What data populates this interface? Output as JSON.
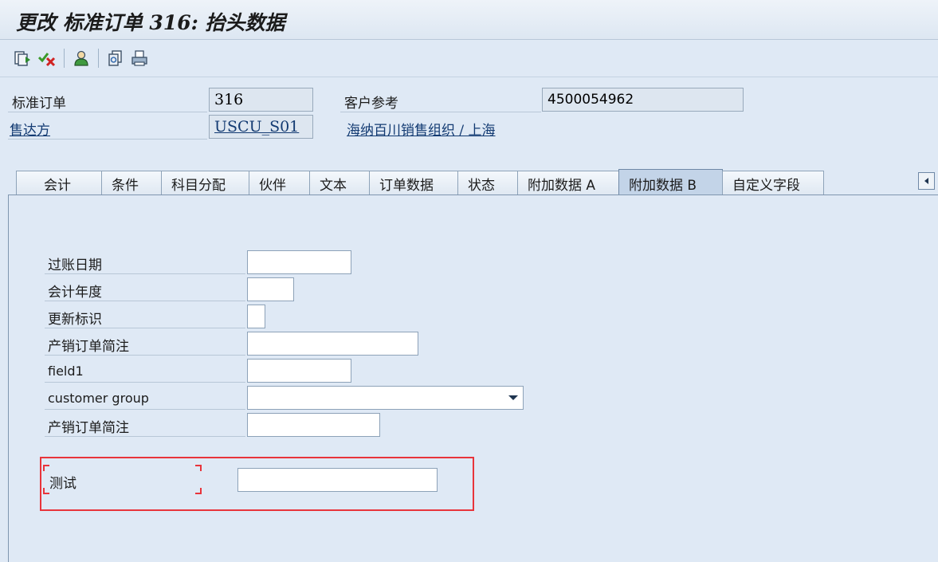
{
  "window": {
    "title": "更改 标准订单 316: 抬头数据"
  },
  "toolbar": {
    "buttons": [
      {
        "icon": "display-change-icon"
      },
      {
        "icon": "check-cancel-icon"
      },
      {
        "icon": "person-icon"
      },
      {
        "icon": "copy-document-icon"
      },
      {
        "icon": "print-icon"
      }
    ]
  },
  "header": {
    "order_type_label": "标准订单",
    "order_number": "316",
    "customer_ref_label": "客户参考",
    "customer_ref_value": "4500054962",
    "sold_to_label": "售达方",
    "sold_to_value": "USCU_S01",
    "sold_to_name": "海纳百川销售组织 / 上海"
  },
  "tabs": [
    {
      "label": "会计",
      "active": false
    },
    {
      "label": "条件",
      "active": false
    },
    {
      "label": "科目分配",
      "active": false
    },
    {
      "label": "伙伴",
      "active": false
    },
    {
      "label": "文本",
      "active": false
    },
    {
      "label": "订单数据",
      "active": false
    },
    {
      "label": "状态",
      "active": false
    },
    {
      "label_cn": "附加数据",
      "label_suffix": "A",
      "active": false
    },
    {
      "label_cn": "附加数据",
      "label_suffix": "B",
      "active": true
    },
    {
      "label": "自定义字段",
      "active": false
    }
  ],
  "fields": {
    "posting_date": {
      "label": "过账日期",
      "value": ""
    },
    "fiscal_year": {
      "label": "会计年度",
      "value": ""
    },
    "update_flag": {
      "label": "更新标识",
      "value": ""
    },
    "order_note_1": {
      "label": "产销订单简注",
      "value": ""
    },
    "field1": {
      "label": "field1",
      "value": ""
    },
    "customer_group": {
      "label": "customer group",
      "value": ""
    },
    "order_note_2": {
      "label": "产销订单简注",
      "value": ""
    },
    "test": {
      "label": "测试",
      "value": ""
    }
  },
  "colors": {
    "highlight": "#e8343b",
    "background": "#dfe9f5",
    "link": "#123a72"
  }
}
